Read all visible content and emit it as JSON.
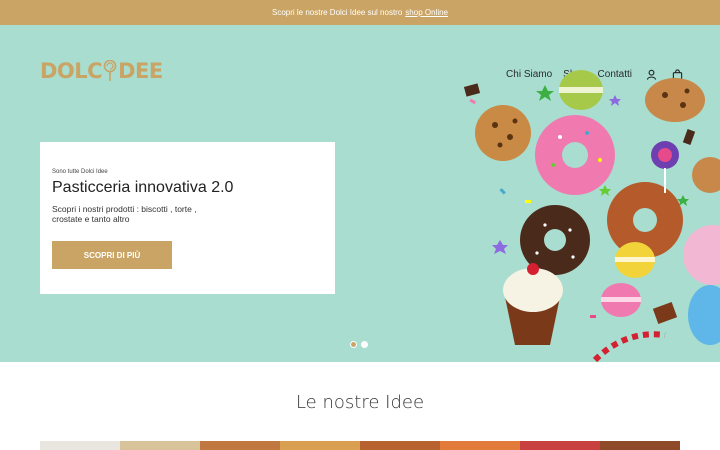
{
  "announcement": {
    "text": "Scopri le nostre Dolci Idee sul nostro",
    "link": "shop Online"
  },
  "logo": {
    "left": "DOLC",
    "right": "DEE"
  },
  "nav": {
    "items": [
      "Chi Siamo",
      "Shop",
      "Contatti"
    ]
  },
  "icons": [
    "lollipop-icon",
    "account-icon",
    "cart-icon"
  ],
  "hero": {
    "eyebrow": "Sono tutte Dolci Idee",
    "title": "Pasticceria innovativa 2.0",
    "description": "Scopri i nostri prodotti : biscotti , torte , crostate e tanto altro",
    "cta": "SCOPRI DI PIÙ",
    "slides_total": 2,
    "active_slide": 1
  },
  "section": {
    "title": "Le nostre Idee"
  },
  "colors": {
    "gold": "#c9a464",
    "mint": "#a8ddcf",
    "text": "#222222"
  }
}
